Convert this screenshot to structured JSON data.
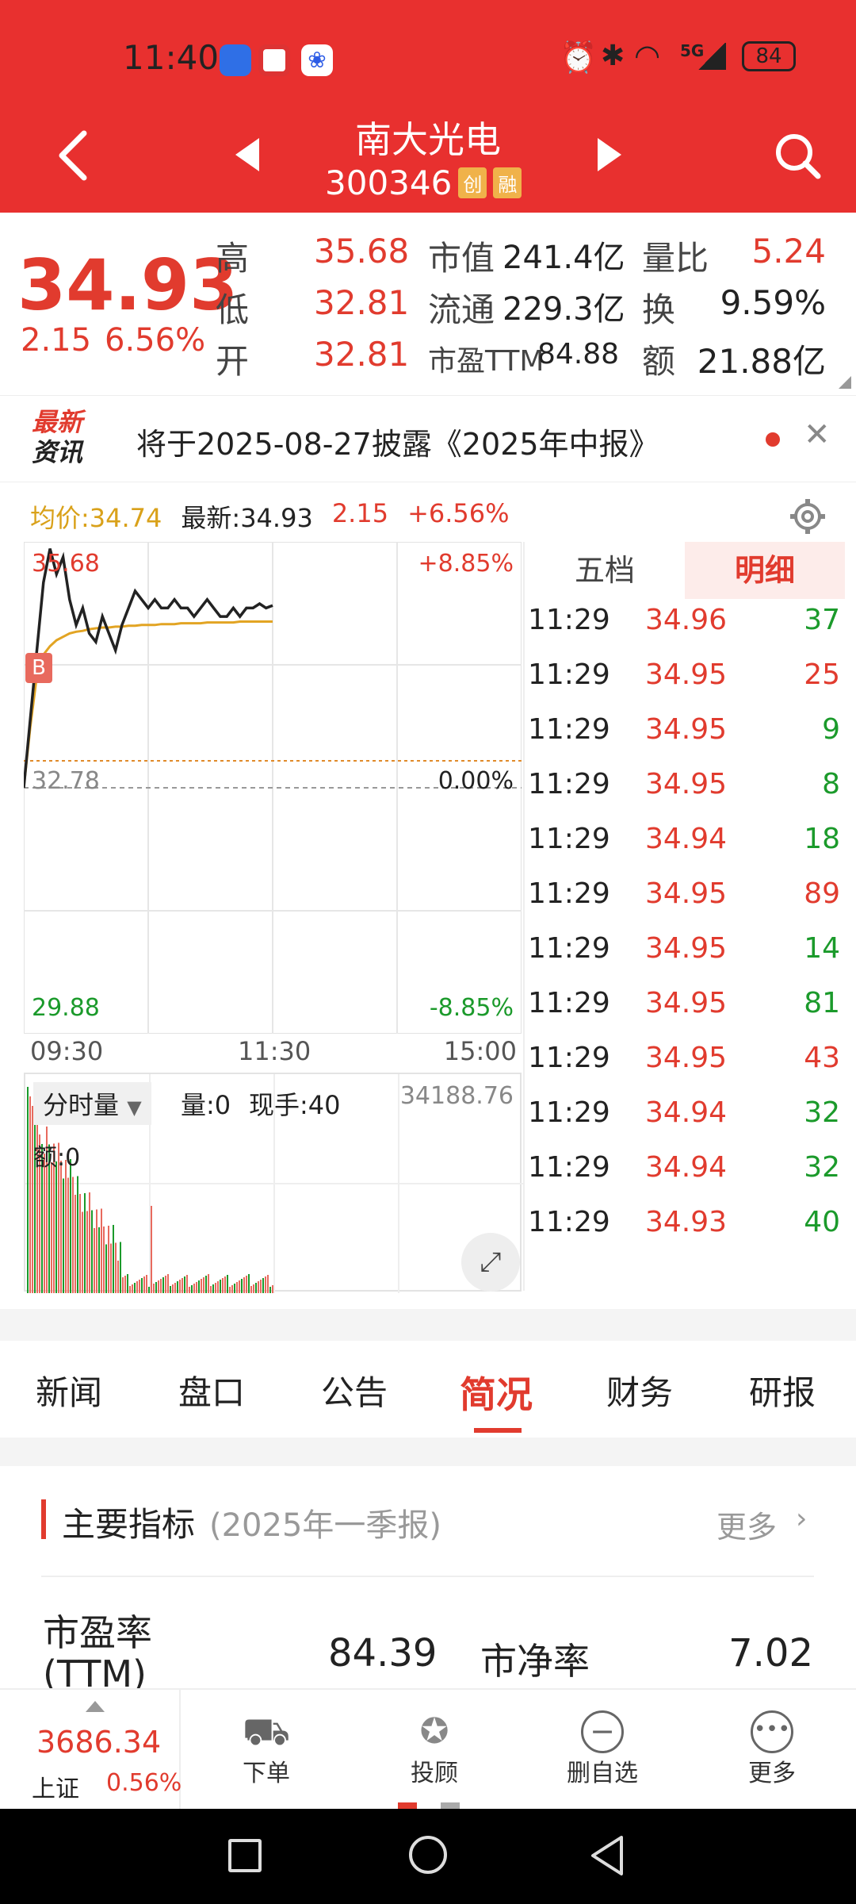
{
  "status_bar": {
    "time": "11:40",
    "net": "5G",
    "battery": "84"
  },
  "header": {
    "name": "南大光电",
    "code": "300346",
    "badge1": "创",
    "badge2": "融"
  },
  "quote": {
    "price": "34.93",
    "change": "2.15",
    "pct": "6.56%",
    "high_l": "高",
    "high": "35.68",
    "low_l": "低",
    "low": "32.81",
    "open_l": "开",
    "open": "32.81",
    "mcap_l": "市值",
    "mcap": "241.4亿",
    "float_l": "流通",
    "float": "229.3亿",
    "pe_l": "市盈TTM",
    "pe": "84.88",
    "vr_l": "量比",
    "vr": "5.24",
    "to_l": "换",
    "to": "9.59%",
    "amt_l": "额",
    "amt": "21.88亿"
  },
  "news": {
    "logo1": "最新",
    "logo2": "资讯",
    "text": "将于2025-08-27披露《2025年中报》"
  },
  "chart_info": {
    "avg": "均价:34.74",
    "latest": "最新:34.93",
    "chg": "2.15",
    "pct": "+6.56%"
  },
  "chart_data": {
    "type": "line",
    "x_ticks": [
      "09:30",
      "11:30",
      "15:00"
    ],
    "y_top": "35.68",
    "y_mid": "32.78",
    "y_bot": "29.88",
    "pct_top": "+8.85%",
    "pct_mid": "0.00%",
    "pct_bot": "-8.85%",
    "ylim": [
      29.88,
      35.68
    ],
    "series": [
      {
        "values": [
          32.78,
          33.6,
          34.4,
          35.2,
          35.6,
          35.3,
          35.5,
          35.0,
          34.7,
          34.9,
          34.6,
          34.5,
          34.8,
          34.6,
          34.4,
          34.7,
          34.9,
          35.1,
          35.0,
          34.9,
          35.0,
          34.9,
          34.9,
          35.0,
          34.9,
          34.9,
          34.8,
          34.9,
          35.0,
          34.9,
          34.8,
          34.8,
          34.9,
          34.8,
          34.9,
          34.9,
          34.95,
          34.9,
          34.93
        ]
      },
      {
        "values": [
          32.78,
          33.5,
          34.1,
          34.35,
          34.45,
          34.52,
          34.56,
          34.6,
          34.62,
          34.63,
          34.65,
          34.66,
          34.67,
          34.67,
          34.68,
          34.68,
          34.69,
          34.69,
          34.7,
          34.7,
          34.7,
          34.71,
          34.71,
          34.71,
          34.72,
          34.72,
          34.72,
          34.72,
          34.73,
          34.73,
          34.73,
          34.73,
          34.73,
          34.74,
          34.74,
          34.74,
          34.74,
          34.74,
          34.74
        ]
      }
    ]
  },
  "volume": {
    "label": "分时量",
    "vol": "量:0",
    "hand": "现手:40",
    "max": "34188.76",
    "amt": "额:0"
  },
  "tabs_right": [
    "五档",
    "明细"
  ],
  "ticks": [
    [
      "11:29",
      "34.96",
      "37"
    ],
    [
      "11:29",
      "34.95",
      "25"
    ],
    [
      "11:29",
      "34.95",
      "9"
    ],
    [
      "11:29",
      "34.95",
      "8"
    ],
    [
      "11:29",
      "34.94",
      "18"
    ],
    [
      "11:29",
      "34.95",
      "89"
    ],
    [
      "11:29",
      "34.95",
      "14"
    ],
    [
      "11:29",
      "34.95",
      "81"
    ],
    [
      "11:29",
      "34.95",
      "43"
    ],
    [
      "11:29",
      "34.94",
      "32"
    ],
    [
      "11:29",
      "34.94",
      "32"
    ],
    [
      "11:29",
      "34.93",
      "40"
    ]
  ],
  "tick_colors": [
    "green",
    "red",
    "green",
    "green",
    "green",
    "red",
    "green",
    "green",
    "red",
    "green",
    "green",
    "green"
  ],
  "tabs": [
    "新闻",
    "盘口",
    "公告",
    "简况",
    "财务",
    "研报"
  ],
  "section": {
    "title": "主要指标",
    "sub": "(2025年一季报)",
    "more": "更多"
  },
  "metrics": {
    "pe_l": "市盈率",
    "pe_l2": "(TTM)",
    "pe": "84.39",
    "pb_l": "市净率",
    "pb": "7.02"
  },
  "bottom": {
    "index": "3686.34",
    "index_name": "上证",
    "index_pct": "0.56%",
    "b1": "下单",
    "b2": "投顾",
    "b3": "删自选",
    "b4": "更多"
  }
}
